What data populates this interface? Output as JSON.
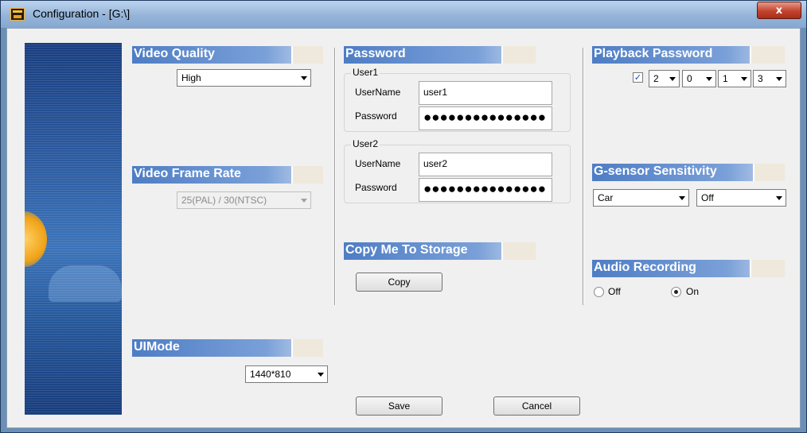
{
  "window": {
    "title": "Configuration - [G:\\]",
    "close_label": "x"
  },
  "video_quality": {
    "heading": "Video Quality",
    "value": "High"
  },
  "video_frame_rate": {
    "heading": "Video Frame Rate",
    "value": "25(PAL) / 30(NTSC)"
  },
  "ui_mode": {
    "heading": "UIMode",
    "value": "1440*810"
  },
  "password": {
    "heading": "Password",
    "users": [
      {
        "group_label": "User1",
        "username_label": "UserName",
        "username": "user1",
        "password_label": "Password",
        "password_mask": "●●●●●●●●●●●●●●●"
      },
      {
        "group_label": "User2",
        "username_label": "UserName",
        "username": "user2",
        "password_label": "Password",
        "password_mask": "●●●●●●●●●●●●●●●"
      }
    ]
  },
  "copy_to_storage": {
    "heading": "Copy Me To Storage",
    "button_label": "Copy"
  },
  "playback_password": {
    "heading": "Playback Password",
    "enabled": true,
    "checkbox_mark": "✓",
    "digits": [
      "2",
      "0",
      "1",
      "3"
    ]
  },
  "gsensor": {
    "heading": "G-sensor Sensitivity",
    "mode": "Car",
    "level": "Off"
  },
  "audio_recording": {
    "heading": "Audio Recording",
    "off_label": "Off",
    "on_label": "On",
    "selected": "On"
  },
  "footer": {
    "save_label": "Save",
    "cancel_label": "Cancel"
  },
  "colors": {
    "section_header": "#4e7dc4",
    "title_bar": "#95b4d9",
    "close_button": "#c2432d"
  }
}
